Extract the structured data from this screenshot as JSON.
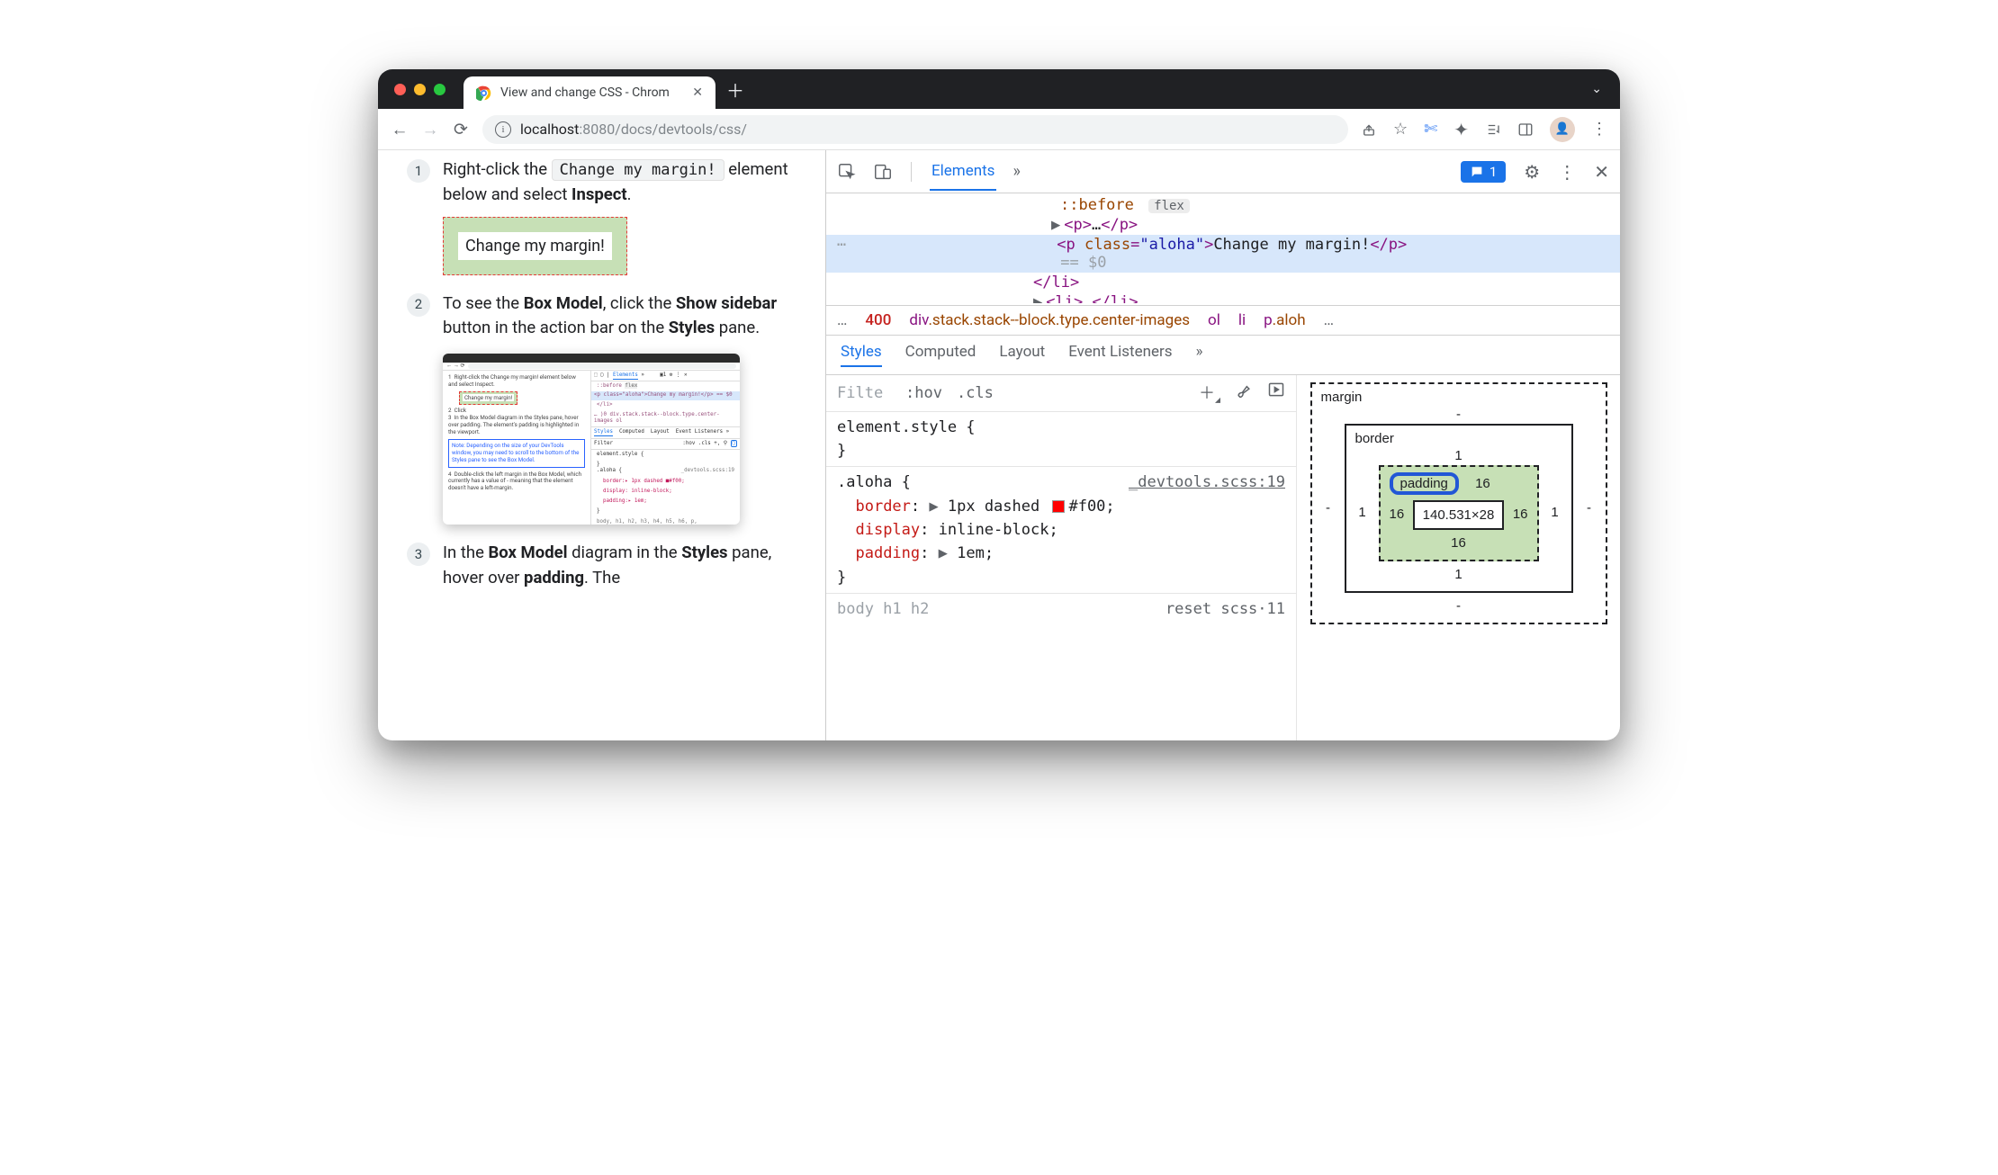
{
  "tab": {
    "title": "View and change CSS - Chrom"
  },
  "url": {
    "host": "localhost",
    "port": ":8080",
    "path": "/docs/devtools/css/"
  },
  "page": {
    "steps": [
      {
        "n": "1",
        "pre": "Right-click the ",
        "code": "Change my margin!",
        "mid": " element below and select ",
        "bold": "Inspect",
        "post": "."
      },
      {
        "n": "2",
        "parts": [
          "To see the ",
          "Box Model",
          ", click the ",
          "Show sidebar",
          " button in the action bar on the ",
          "Styles",
          " pane."
        ]
      },
      {
        "n": "3",
        "parts": [
          "In the ",
          "Box Model",
          " diagram in the ",
          "Styles",
          " pane, hover over ",
          "padding",
          ". The"
        ]
      }
    ],
    "demo": "Change my margin!"
  },
  "thumb": {
    "url": "localhost:8080/docs/devtools/css/",
    "tabs": [
      "Elements"
    ],
    "before": "::before",
    "flex": "flex",
    "sel": "<p class=\"aloha\">Change my margin!</p> == $0",
    "li": "</li>",
    "crumb": "div.stack.stack--block.type.center-images   ol",
    "subtabs": [
      "Styles",
      "Computed",
      "Layout",
      "Event Listeners"
    ],
    "filter": "Filter",
    "btns": ":hov .cls +,",
    "el": "element.style {",
    "aloha": ".aloha {",
    "src": "_devtools.scss:19",
    "p1": "border:▸ 1px dashed ■#f00;",
    "p2": "display: inline-block;",
    "p3": "padding:▸ 1em;",
    "body": "body, h1, h2, h3, h4, h5, h6, p,",
    "reset": "_reset.scss:11",
    "step1": "Right-click the  Change my margin!  element below and select Inspect.",
    "demo": "Change my margin!",
    "step2": "Click",
    "step3": "In the Box Model diagram in the Styles pane, hover over padding. The element's padding is highlighted in the viewport.",
    "note": "Note: Depending on the size of your DevTools window, you may need to scroll to the bottom of the Styles pane to see the Box Model.",
    "step4": "Double-click the left margin in the Box Model, which currently has a value of - meaning that the element doesn't have a left-margin."
  },
  "devtools": {
    "tab_elements": "Elements",
    "issue_count": "1",
    "dom": {
      "before": "::before",
      "flex": "flex",
      "p_collapsed_open": "<p>",
      "p_collapsed_dots": "…",
      "p_collapsed_close": "</p>",
      "sel_open1": "<p ",
      "sel_attr": "class",
      "sel_eq": "=",
      "sel_val": "\"aloha\"",
      "sel_open2": ">",
      "sel_txt": "Change my margin!",
      "sel_close": "</p>",
      "eq0": "== $0",
      "li_close": "</li>",
      "li_next": "<li>…</li>"
    },
    "crumbs": {
      "dots": "…",
      "num": "400",
      "main": "div",
      "main_cls": ".stack.stack--block.type.center-images",
      "ol": "ol",
      "li": "li",
      "p": "p",
      "p_cls": ".aloh",
      "dots2": "…"
    },
    "subtabs": [
      "Styles",
      "Computed",
      "Layout",
      "Event Listeners"
    ],
    "styles": {
      "filter_ph": "Filte",
      "hov": ":hov",
      "cls": ".cls",
      "element_style": "element.style {",
      "brace_close": "}",
      "aloha_sel": ".aloha {",
      "aloha_src": "_devtools.scss:19",
      "props": {
        "border_k": "border",
        "border_v": "1px dashed ",
        "border_hex": "#f00",
        "display_k": "display",
        "display_v": "inline-block",
        "padding_k": "padding",
        "padding_v": "1em"
      },
      "body_sel": "body   h1   h2",
      "body_src": "reset scss·11"
    },
    "boxmodel": {
      "margin_label": "margin",
      "margin": "-",
      "border_label": "border",
      "border": "1",
      "padding_label": "padding",
      "padding": "16",
      "content": "140.531×28"
    }
  }
}
